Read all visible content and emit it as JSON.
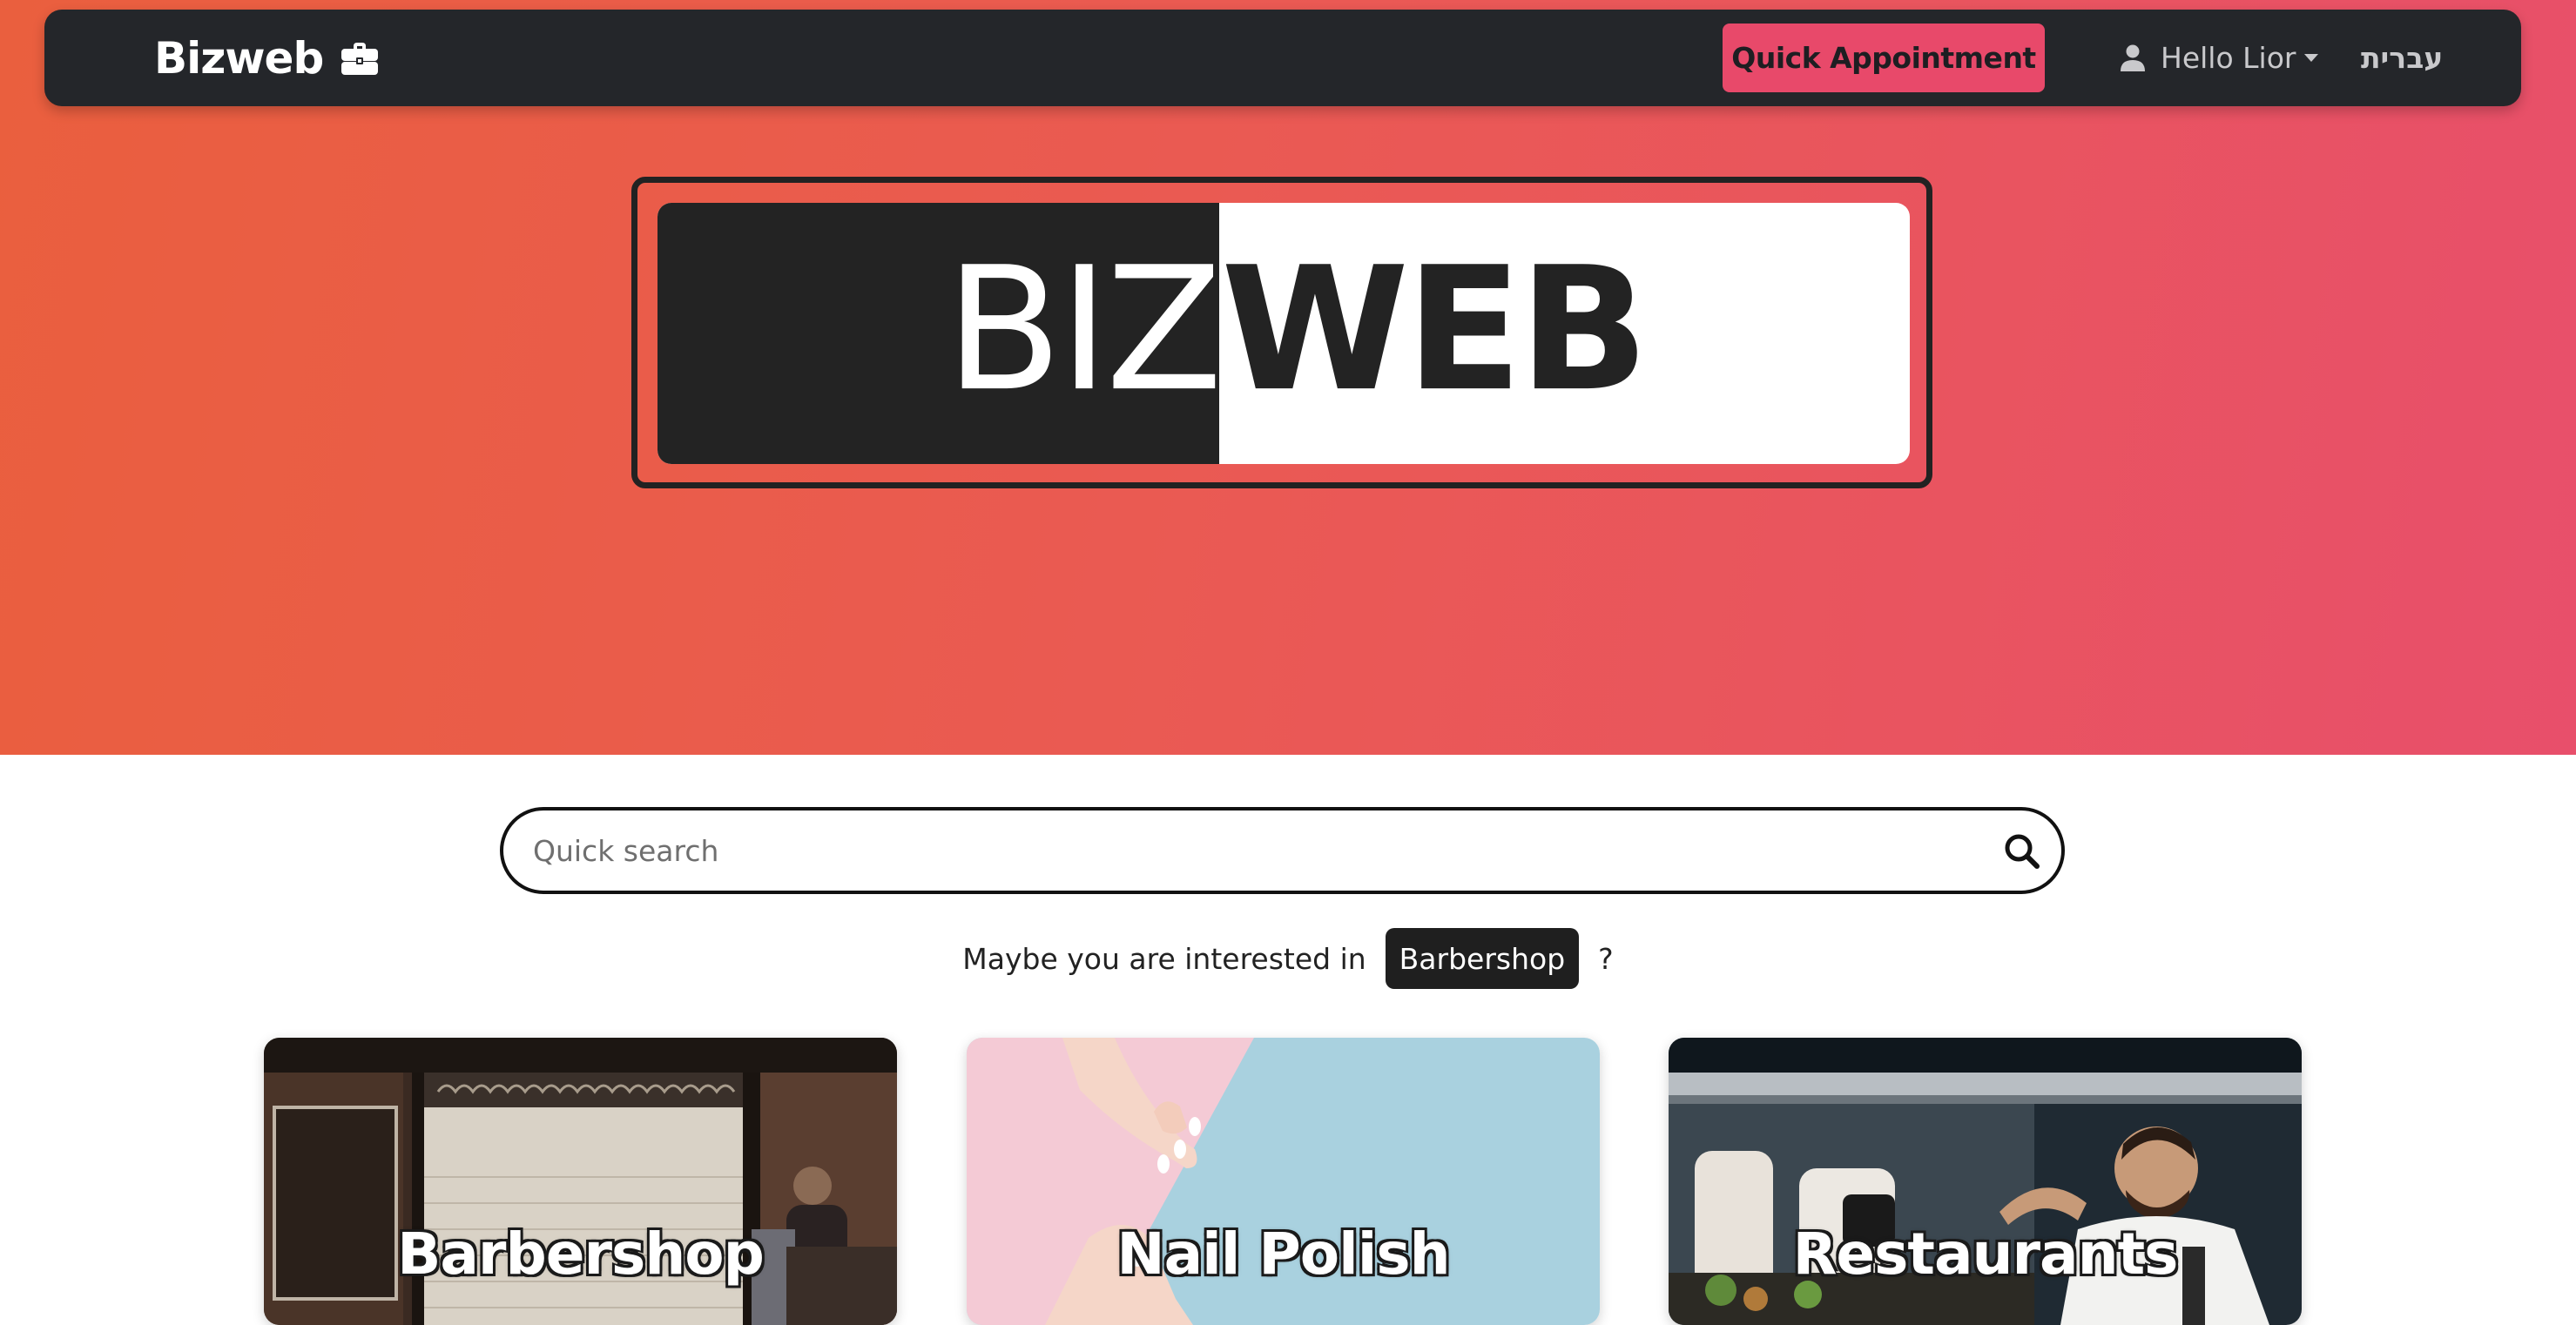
{
  "navbar": {
    "brand": "Bizweb",
    "brand_icon": "briefcase-icon",
    "quick_appointment": "Quick Appointment",
    "user_greeting": "Hello Lior",
    "user_icon": "user-icon",
    "language": "עברית"
  },
  "logo": {
    "left_text": "BIZ",
    "right_text": "WEB"
  },
  "search": {
    "placeholder": "Quick search",
    "value": "",
    "icon": "search-icon"
  },
  "suggestion": {
    "prefix": "Maybe you are interested in",
    "category": "Barbershop",
    "suffix": "?"
  },
  "categories": [
    {
      "label": "Barbershop"
    },
    {
      "label": "Nail Polish"
    },
    {
      "label": "Restaurants"
    }
  ],
  "colors": {
    "hero_gradient_start": "#ea5f3e",
    "hero_gradient_end": "#e84f6b",
    "navbar_bg": "#24262a",
    "accent": "#e8496a",
    "dark": "#232323"
  }
}
